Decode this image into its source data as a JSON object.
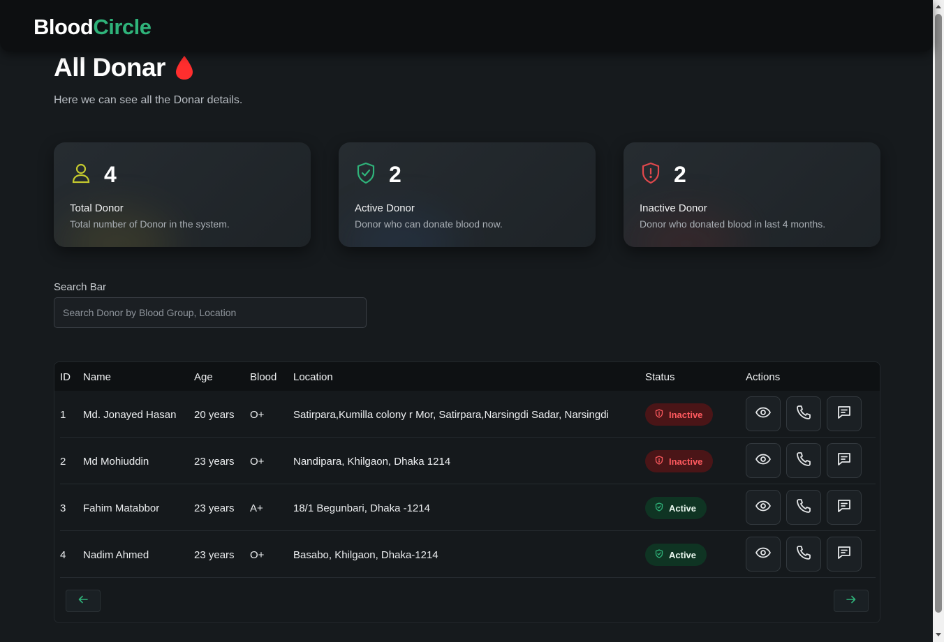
{
  "brand": {
    "part1": "Blood",
    "part2": "Circle"
  },
  "page": {
    "title": "All Donar",
    "subtitle": "Here we can see all the Donar details."
  },
  "stats": [
    {
      "icon": "user-icon",
      "count": "4",
      "label": "Total Donor",
      "desc": "Total number of Donor in the system.",
      "color": "#c4c92e"
    },
    {
      "icon": "shield-check-icon",
      "count": "2",
      "label": "Active Donor",
      "desc": "Donor who can donate blood now.",
      "color": "#2fb37a"
    },
    {
      "icon": "shield-alert-icon",
      "count": "2",
      "label": "Inactive Donor",
      "desc": "Donor who donated blood in last 4 months.",
      "color": "#e0484c"
    }
  ],
  "search": {
    "label": "Search Bar",
    "placeholder": "Search Donor by Blood Group, Location",
    "value": ""
  },
  "table": {
    "headers": {
      "id": "ID",
      "name": "Name",
      "age": "Age",
      "blood": "Blood",
      "location": "Location",
      "status": "Status",
      "actions": "Actions"
    },
    "rows": [
      {
        "id": "1",
        "name": "Md. Jonayed Hasan",
        "age": "20 years",
        "blood": "O+",
        "location": "Satirpara,Kumilla colony r Mor, Satirpara,Narsingdi Sadar, Narsingdi",
        "status": "Inactive"
      },
      {
        "id": "2",
        "name": "Md Mohiuddin",
        "age": "23 years",
        "blood": "O+",
        "location": "Nandipara, Khilgaon, Dhaka 1214",
        "status": "Inactive"
      },
      {
        "id": "3",
        "name": "Fahim Matabbor",
        "age": "23 years",
        "blood": "A+",
        "location": "18/1 Begunbari, Dhaka -1214",
        "status": "Active"
      },
      {
        "id": "4",
        "name": "Nadim Ahmed",
        "age": "23 years",
        "blood": "O+",
        "location": "Basabo, Khilgaon, Dhaka-1214",
        "status": "Active"
      }
    ]
  },
  "pagination": {
    "prev_icon": "arrow-left-icon",
    "next_icon": "arrow-right-icon"
  },
  "colors": {
    "brand_green": "#2fb37a",
    "danger_red": "#ff5a5f",
    "background": "#161a1d"
  }
}
